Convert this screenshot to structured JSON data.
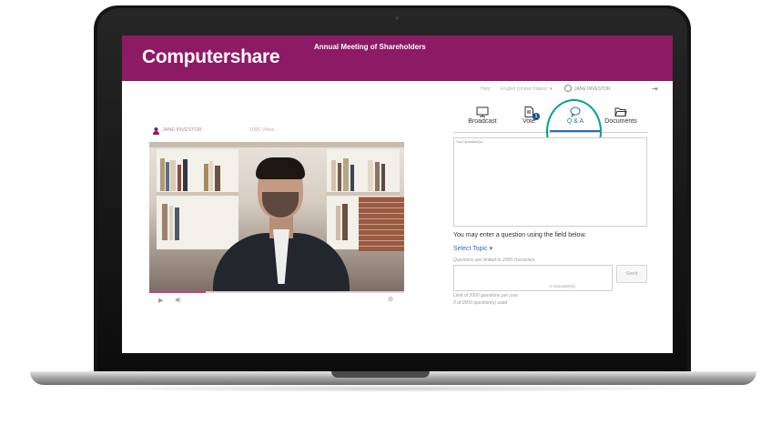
{
  "header": {
    "brand": "Computershare",
    "meeting_title": "Annual Meeting of Shareholders",
    "bg_color": "#8c1a64"
  },
  "topbar": {
    "help": "Help",
    "language": "English (United States)",
    "user": "JANE INVESTOR"
  },
  "left_panel": {
    "user": "JANE INVESTOR",
    "votes": "1086 Votes",
    "video_progress": 0.22
  },
  "tabs": [
    {
      "label": "Broadcast",
      "icon": "monitor-icon"
    },
    {
      "label": "Vote",
      "icon": "document-icon",
      "badge": "1"
    },
    {
      "label": "Q & A",
      "icon": "speech-bubble-icon",
      "active": true
    },
    {
      "label": "Documents",
      "icon": "folder-icon"
    }
  ],
  "qa": {
    "question_placeholder": "Your question(s)",
    "info": "You may enter a question using the field below.",
    "select_topic": "Select Topic ▾",
    "limit_note": "Questions are limited to 2000  characters",
    "char_count": "0 character(s)",
    "send_label": "Send",
    "per_user": "Limit of 2000 questions per user",
    "used": "0 of 2000 question(s) used"
  },
  "colors": {
    "accent_blue": "#2d6fb2",
    "highlight_ring": "#00a08a",
    "progress": "#c2408c"
  }
}
